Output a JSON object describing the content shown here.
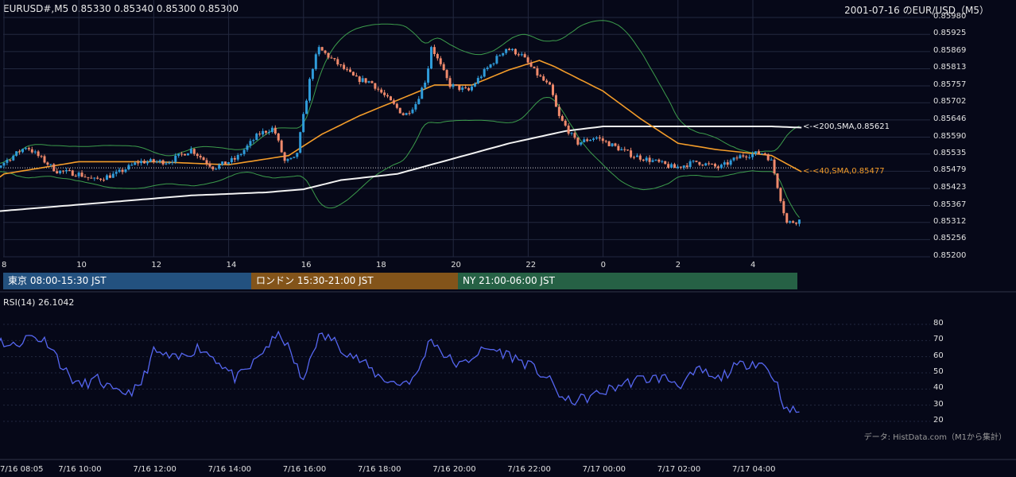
{
  "header": {
    "symbol_ohlc": "EURUSD#,M5 0.85330 0.85340 0.85300 0.85300",
    "date_pair": "2001-07-16 のEUR/USD（M5）"
  },
  "colors": {
    "background": "#060818",
    "grid": "#23283f",
    "candle_up": "#2f9bd9",
    "candle_down": "#f08a6c",
    "sma40": "#f39c2a",
    "sma200": "#f2f2f2",
    "bollinger": "#3c9c4c",
    "rsi": "#5566f0",
    "session_tokyo": "#23517f",
    "session_london": "#83541a",
    "session_ny": "#266145"
  },
  "price_panel": {
    "y_ticks": [
      "0.85980",
      "0.85925",
      "0.85869",
      "0.85813",
      "0.85757",
      "0.85702",
      "0.85646",
      "0.85590",
      "0.85535",
      "0.85479",
      "0.85423",
      "0.85367",
      "0.85312",
      "0.85256",
      "0.85200"
    ],
    "x_ticks": [
      "8",
      "10",
      "12",
      "14",
      "16",
      "18",
      "20",
      "22",
      "0",
      "2",
      "4"
    ],
    "annotations": [
      {
        "text": "<-<200,SMA,0.85621",
        "color": "#f2f2f2"
      },
      {
        "text": "<-<40,SMA,0.85477",
        "color": "#f39c2a"
      }
    ]
  },
  "sessions": [
    {
      "label": "東京 08:00-15:30 JST",
      "color": "#23517f"
    },
    {
      "label": "ロンドン 15:30-21:00 JST",
      "color": "#83541a"
    },
    {
      "label": "NY 21:00-06:00 JST",
      "color": "#266145"
    }
  ],
  "rsi_panel": {
    "label": "RSI(14) 26.1042",
    "y_ticks": [
      "80",
      "70",
      "60",
      "50",
      "40",
      "30",
      "20"
    ]
  },
  "bottom_axis": [
    "7/16 08:05",
    "7/16 10:00",
    "7/16 12:00",
    "7/16 14:00",
    "7/16 16:00",
    "7/16 18:00",
    "7/16 20:00",
    "7/16 22:00",
    "7/17 00:00",
    "7/17 02:00",
    "7/17 04:00"
  ],
  "credit": "データ: HistData.com（M1から集計）",
  "chart_data": [
    {
      "type": "candlestick",
      "title": "2001-07-16 のEUR/USD（M5）",
      "ylim": [
        0.852,
        0.8598
      ],
      "x_hours": [
        8,
        10,
        12,
        14,
        16,
        18,
        20,
        22,
        24,
        26,
        28
      ],
      "close_anchors": [
        [
          7.0,
          0.8549
        ],
        [
          7.8,
          0.8549
        ],
        [
          8.6,
          0.8556
        ],
        [
          9.0,
          0.8552
        ],
        [
          9.4,
          0.8548
        ],
        [
          10.0,
          0.8547
        ],
        [
          10.4,
          0.8545
        ],
        [
          11.0,
          0.8547
        ],
        [
          11.6,
          0.8551
        ],
        [
          12.4,
          0.8551
        ],
        [
          13.0,
          0.8555
        ],
        [
          13.6,
          0.8549
        ],
        [
          14.2,
          0.8552
        ],
        [
          14.8,
          0.856
        ],
        [
          15.2,
          0.8562
        ],
        [
          15.5,
          0.8551
        ],
        [
          15.8,
          0.8552
        ],
        [
          16.2,
          0.858
        ],
        [
          16.4,
          0.8588
        ],
        [
          16.9,
          0.8583
        ],
        [
          17.4,
          0.8578
        ],
        [
          17.8,
          0.8577
        ],
        [
          18.2,
          0.8572
        ],
        [
          18.7,
          0.8566
        ],
        [
          19.0,
          0.857
        ],
        [
          19.3,
          0.8579
        ],
        [
          19.4,
          0.8589
        ],
        [
          19.9,
          0.8576
        ],
        [
          20.4,
          0.8574
        ],
        [
          20.8,
          0.858
        ],
        [
          21.4,
          0.8588
        ],
        [
          21.8,
          0.8586
        ],
        [
          22.2,
          0.858
        ],
        [
          22.6,
          0.8575
        ],
        [
          22.8,
          0.8566
        ],
        [
          23.3,
          0.8557
        ],
        [
          23.8,
          0.8559
        ],
        [
          24.3,
          0.8556
        ],
        [
          24.8,
          0.8553
        ],
        [
          25.4,
          0.8551
        ],
        [
          25.9,
          0.8549
        ],
        [
          26.5,
          0.8551
        ],
        [
          27.1,
          0.8549
        ],
        [
          27.7,
          0.8553
        ],
        [
          28.3,
          0.8554
        ],
        [
          28.5,
          0.8551
        ],
        [
          28.7,
          0.8541
        ],
        [
          28.9,
          0.8531
        ],
        [
          29.3,
          0.8532
        ]
      ],
      "sma40_anchors": [
        [
          7.0,
          0.8538
        ],
        [
          8.0,
          0.8547
        ],
        [
          10.0,
          0.8551
        ],
        [
          12.0,
          0.8551
        ],
        [
          14.0,
          0.855
        ],
        [
          15.6,
          0.8553
        ],
        [
          16.5,
          0.856
        ],
        [
          17.5,
          0.8566
        ],
        [
          18.5,
          0.8571
        ],
        [
          19.5,
          0.8576
        ],
        [
          20.5,
          0.8576
        ],
        [
          21.5,
          0.8581
        ],
        [
          22.3,
          0.8584
        ],
        [
          22.7,
          0.8582
        ],
        [
          24.0,
          0.8574
        ],
        [
          25.0,
          0.8565
        ],
        [
          26.0,
          0.8557
        ],
        [
          27.0,
          0.8555
        ],
        [
          28.5,
          0.8553
        ],
        [
          29.3,
          0.85477
        ]
      ],
      "sma200_anchors": [
        [
          7.0,
          0.8534
        ],
        [
          10.0,
          0.8537
        ],
        [
          13.0,
          0.854
        ],
        [
          15.0,
          0.8541
        ],
        [
          16.0,
          0.8542
        ],
        [
          17.0,
          0.8545
        ],
        [
          18.5,
          0.8547
        ],
        [
          20.0,
          0.8552
        ],
        [
          21.5,
          0.8557
        ],
        [
          23.0,
          0.8561
        ],
        [
          24.0,
          0.85625
        ],
        [
          26.0,
          0.85625
        ],
        [
          28.5,
          0.85625
        ],
        [
          29.3,
          0.85621
        ]
      ]
    },
    {
      "type": "line",
      "name": "RSI(14)",
      "ylim": [
        15,
        85
      ],
      "last_value": 26.1042,
      "anchors": [
        [
          7.0,
          67
        ],
        [
          7.4,
          63
        ],
        [
          7.9,
          70
        ],
        [
          8.2,
          66
        ],
        [
          8.7,
          73
        ],
        [
          9.2,
          69
        ],
        [
          9.6,
          52
        ],
        [
          10.0,
          42
        ],
        [
          10.5,
          46
        ],
        [
          11.0,
          37
        ],
        [
          11.6,
          40
        ],
        [
          12.0,
          63
        ],
        [
          12.6,
          58
        ],
        [
          13.2,
          66
        ],
        [
          13.7,
          58
        ],
        [
          14.2,
          46
        ],
        [
          14.6,
          54
        ],
        [
          15.0,
          66
        ],
        [
          15.4,
          74
        ],
        [
          15.8,
          55
        ],
        [
          16.0,
          43
        ],
        [
          16.2,
          62
        ],
        [
          16.4,
          72
        ],
        [
          16.7,
          72
        ],
        [
          17.1,
          64
        ],
        [
          17.6,
          56
        ],
        [
          18.0,
          48
        ],
        [
          18.5,
          43
        ],
        [
          19.0,
          47
        ],
        [
          19.4,
          72
        ],
        [
          19.8,
          60
        ],
        [
          20.2,
          54
        ],
        [
          20.6,
          62
        ],
        [
          21.0,
          65
        ],
        [
          21.5,
          61
        ],
        [
          22.0,
          55
        ],
        [
          22.5,
          47
        ],
        [
          23.0,
          32
        ],
        [
          23.5,
          34
        ],
        [
          24.0,
          38
        ],
        [
          24.5,
          43
        ],
        [
          25.0,
          46
        ],
        [
          25.6,
          47
        ],
        [
          26.1,
          43
        ],
        [
          26.6,
          52
        ],
        [
          27.0,
          45
        ],
        [
          27.5,
          53
        ],
        [
          28.0,
          57
        ],
        [
          28.3,
          55
        ],
        [
          28.6,
          46
        ],
        [
          28.9,
          26
        ],
        [
          29.3,
          27
        ]
      ]
    }
  ]
}
